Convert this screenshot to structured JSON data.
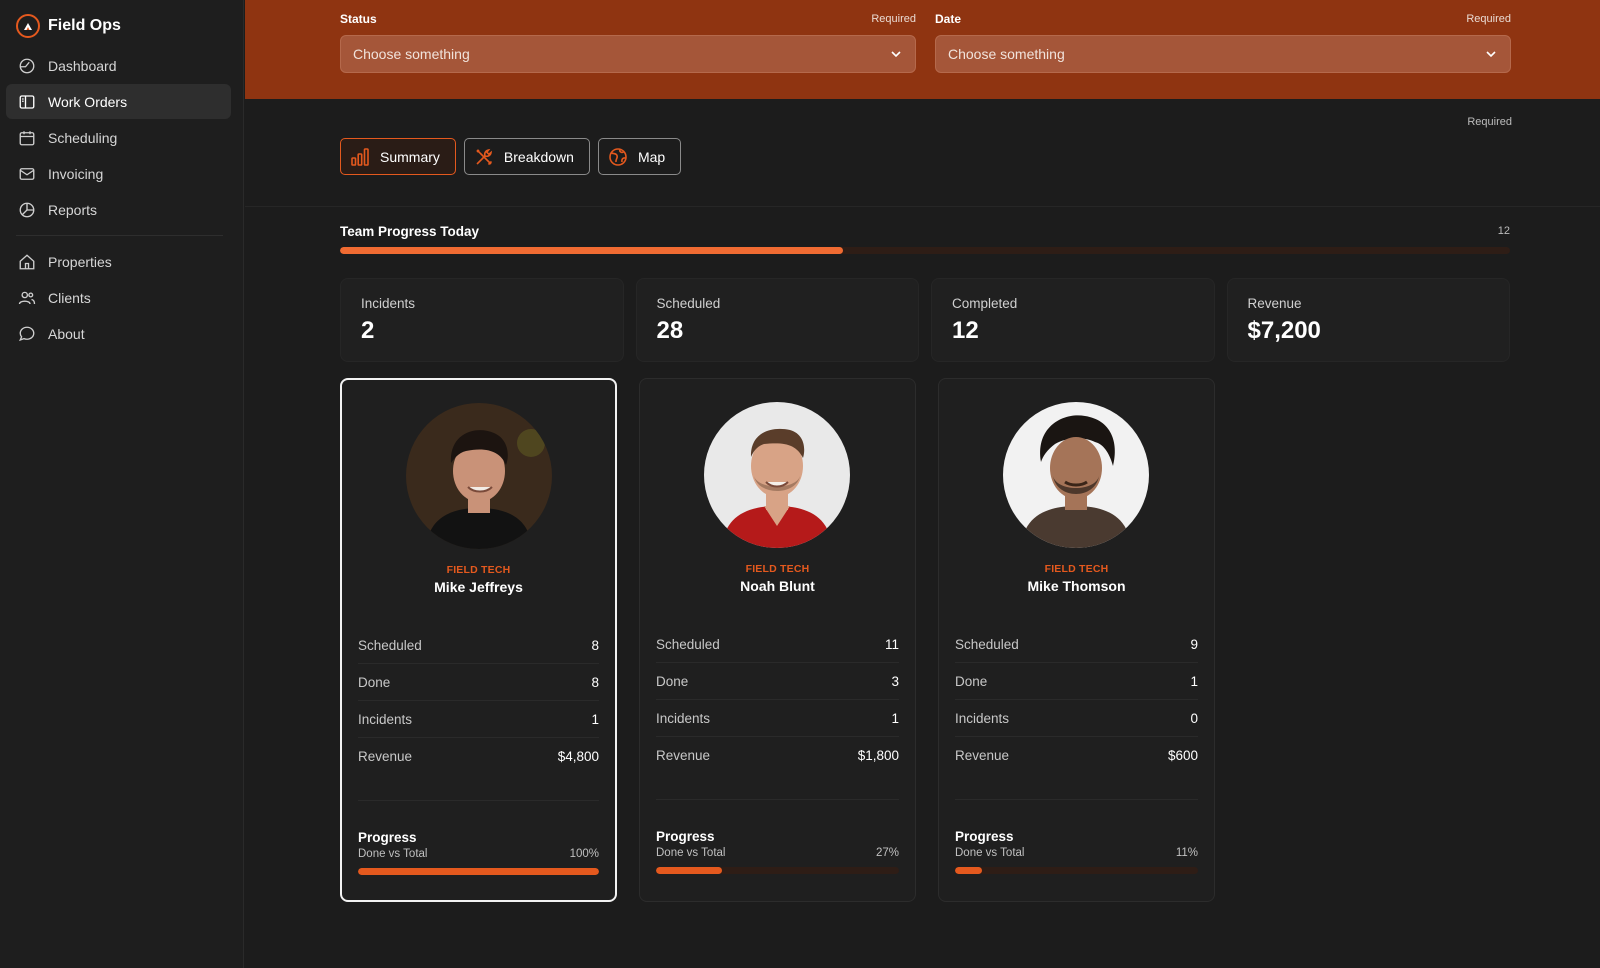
{
  "app": {
    "name": "Field Ops"
  },
  "sidebar": {
    "primary": [
      {
        "label": "Dashboard",
        "icon": "dashboard-icon"
      },
      {
        "label": "Work Orders",
        "icon": "work-orders-icon",
        "active": true
      },
      {
        "label": "Scheduling",
        "icon": "calendar-icon"
      },
      {
        "label": "Invoicing",
        "icon": "mail-icon"
      },
      {
        "label": "Reports",
        "icon": "pie-chart-icon"
      }
    ],
    "secondary": [
      {
        "label": "Properties",
        "icon": "home-icon"
      },
      {
        "label": "Clients",
        "icon": "users-icon"
      },
      {
        "label": "About",
        "icon": "message-icon"
      }
    ]
  },
  "filters": {
    "status": {
      "label": "Status",
      "required": "Required",
      "placeholder": "Choose something"
    },
    "date": {
      "label": "Date",
      "required": "Required",
      "placeholder": "Choose something"
    }
  },
  "tabs": {
    "required": "Required",
    "items": [
      {
        "label": "Summary",
        "icon": "bar-chart-icon",
        "active": true
      },
      {
        "label": "Breakdown",
        "icon": "tools-icon"
      },
      {
        "label": "Map",
        "icon": "globe-icon"
      }
    ]
  },
  "team_progress": {
    "title": "Team Progress Today",
    "count": "12",
    "fraction": 0.43
  },
  "stats": [
    {
      "label": "Incidents",
      "value": "2"
    },
    {
      "label": "Scheduled",
      "value": "28"
    },
    {
      "label": "Completed",
      "value": "12"
    },
    {
      "label": "Revenue",
      "value": "$7,200"
    }
  ],
  "techs": [
    {
      "role": "FIELD TECH",
      "name": "Mike Jeffreys",
      "selected": true,
      "rows": [
        {
          "label": "Scheduled",
          "value": "8"
        },
        {
          "label": "Done",
          "value": "8"
        },
        {
          "label": "Incidents",
          "value": "1"
        },
        {
          "label": "Revenue",
          "value": "$4,800"
        }
      ],
      "progress": {
        "title": "Progress",
        "subtitle": "Done vs Total",
        "percent_label": "100%",
        "percent": 100
      },
      "avatar": {
        "bg": "#3a2a1c",
        "skin": "#c99278",
        "hair": "#1c1410",
        "shirt": "#121212"
      }
    },
    {
      "role": "FIELD TECH",
      "name": "Noah Blunt",
      "selected": false,
      "rows": [
        {
          "label": "Scheduled",
          "value": "11"
        },
        {
          "label": "Done",
          "value": "3"
        },
        {
          "label": "Incidents",
          "value": "1"
        },
        {
          "label": "Revenue",
          "value": "$1,800"
        }
      ],
      "progress": {
        "title": "Progress",
        "subtitle": "Done vs Total",
        "percent_label": "27%",
        "percent": 27
      },
      "avatar": {
        "bg": "#e9e9e9",
        "skin": "#d8a386",
        "hair": "#5a3d2a",
        "shirt": "#b51a1a"
      }
    },
    {
      "role": "FIELD TECH",
      "name": "Mike Thomson",
      "selected": false,
      "rows": [
        {
          "label": "Scheduled",
          "value": "9"
        },
        {
          "label": "Done",
          "value": "1"
        },
        {
          "label": "Incidents",
          "value": "0"
        },
        {
          "label": "Revenue",
          "value": "$600"
        }
      ],
      "progress": {
        "title": "Progress",
        "subtitle": "Done vs Total",
        "percent_label": "11%",
        "percent": 11
      },
      "avatar": {
        "bg": "#f2f2f2",
        "skin": "#a57458",
        "hair": "#1a1512",
        "shirt": "#4a3a30"
      }
    }
  ],
  "colors": {
    "accent": "#e4591e",
    "header": "#8f3411",
    "background": "#1c1c1c"
  }
}
